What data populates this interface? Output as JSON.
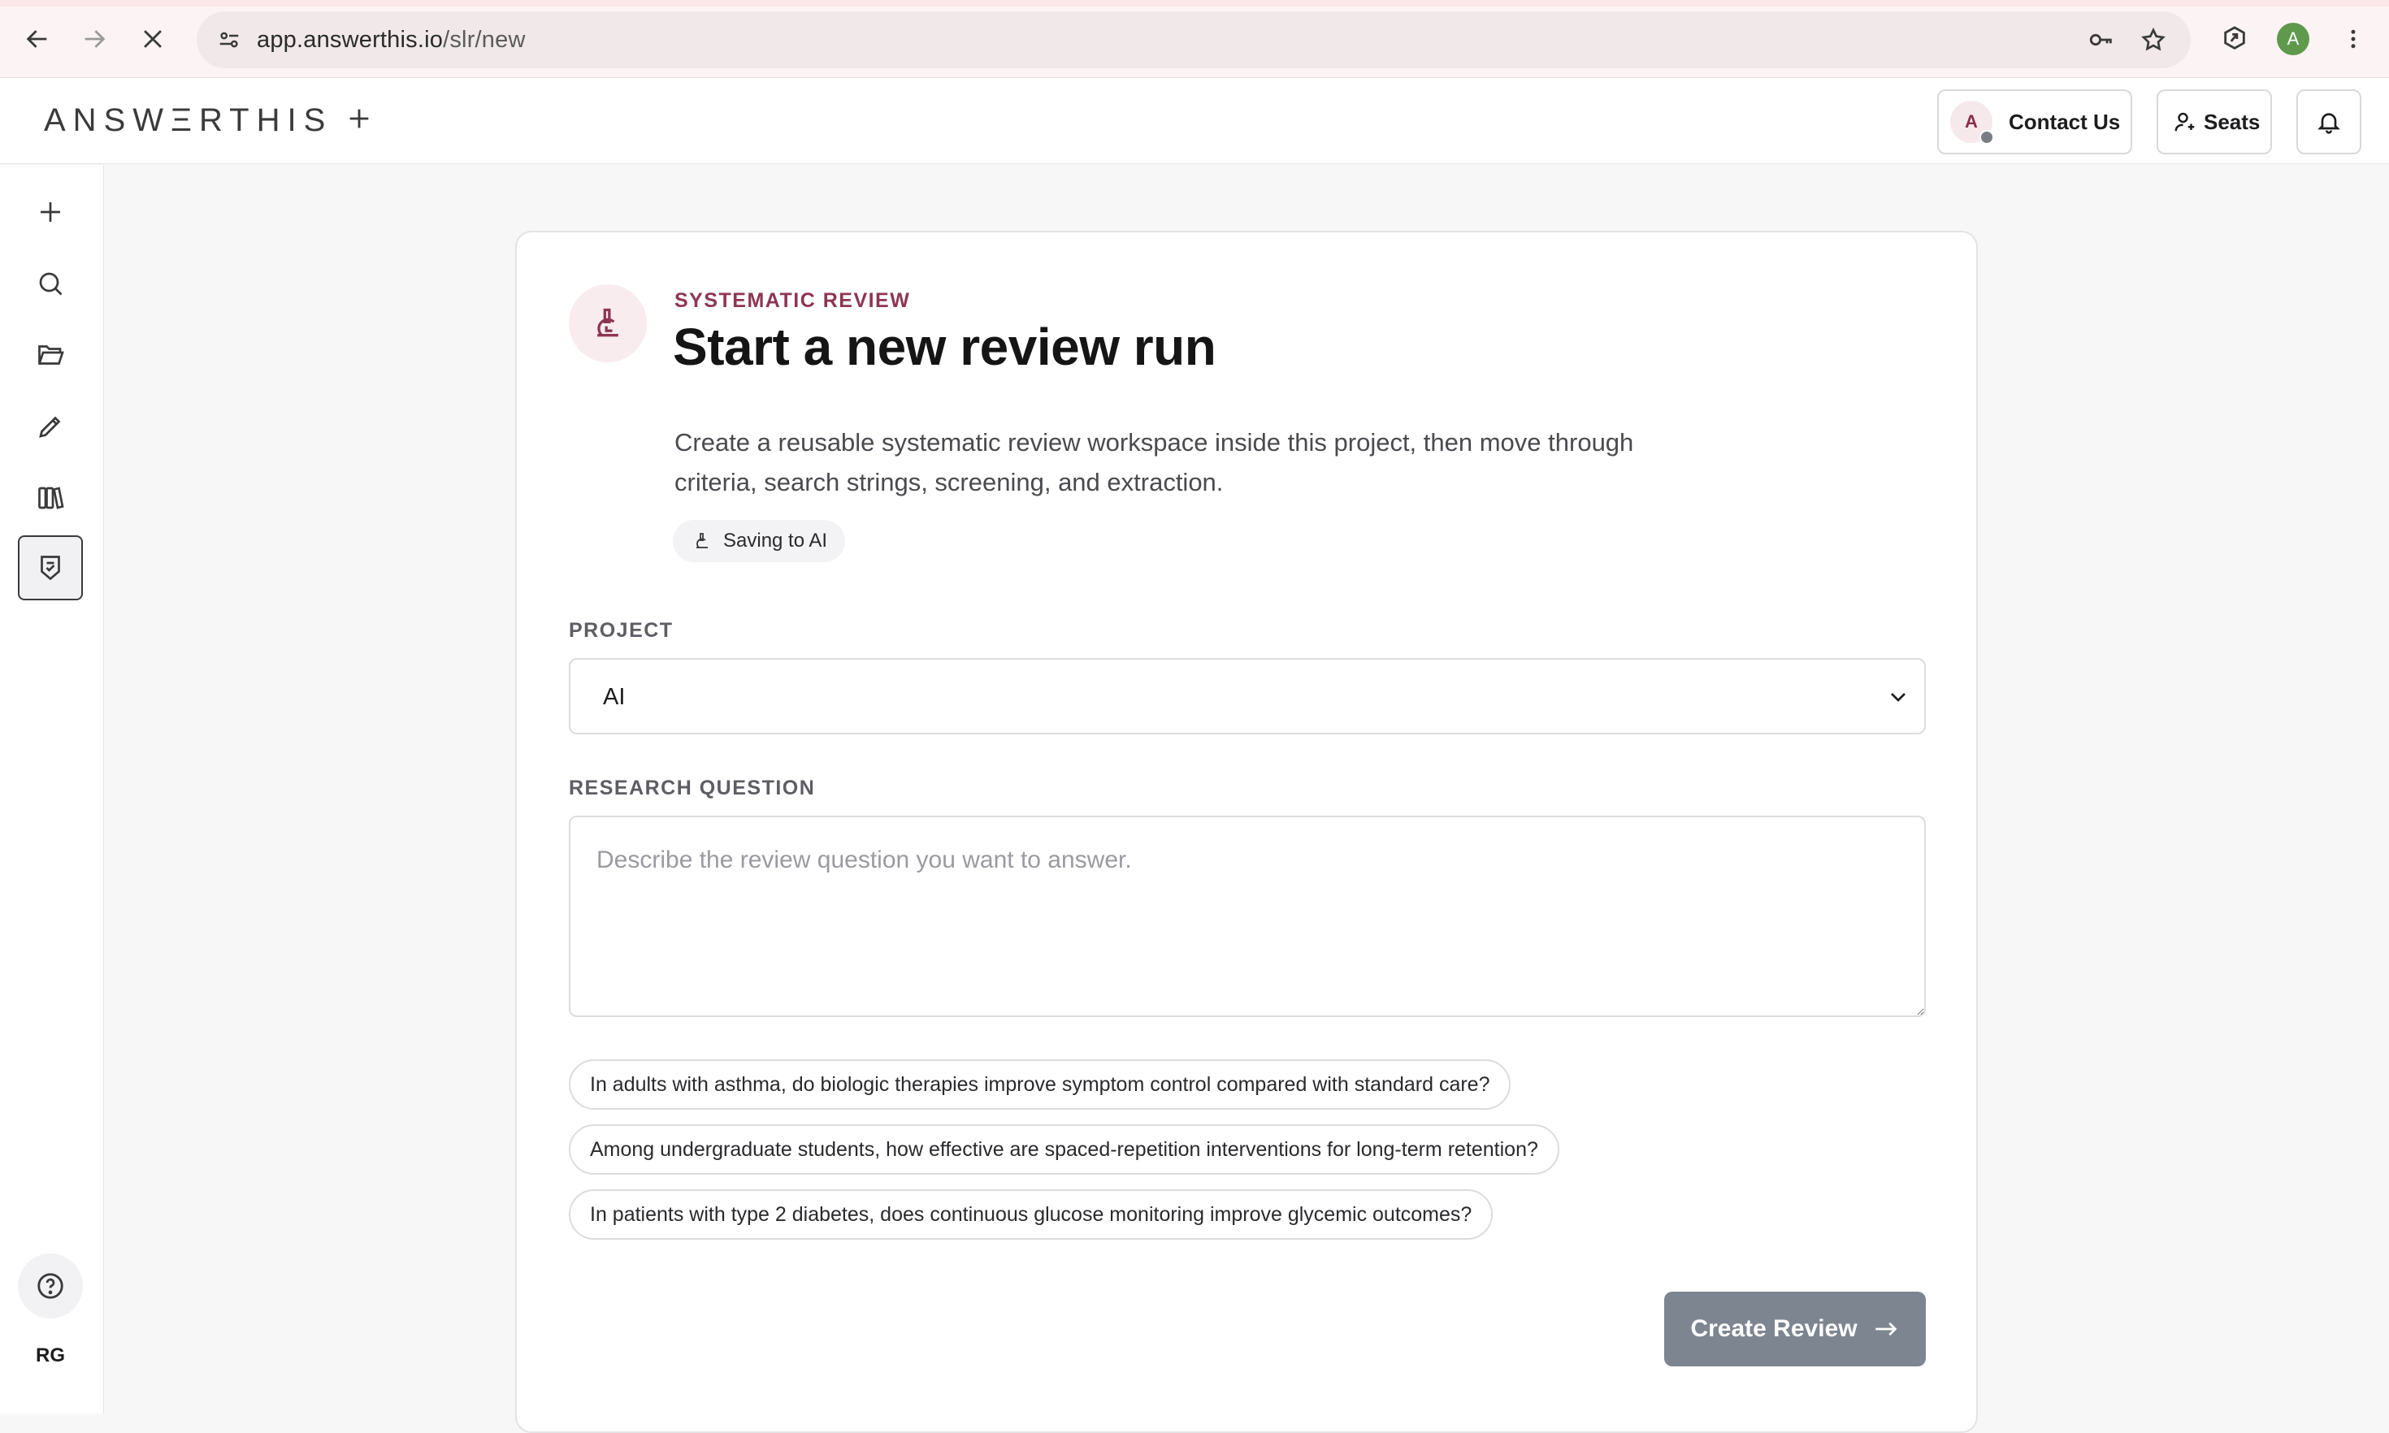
{
  "browser": {
    "url_host": "app.answerthis.io",
    "url_path": "/slr/new",
    "profile_initial": "A"
  },
  "header": {
    "logo": "ANSWΞRTHIS",
    "contact_avatar": "A",
    "contact_label": "Contact Us",
    "seats_label": "Seats"
  },
  "sidebar": {
    "items": [
      "new-icon",
      "search-icon",
      "folder-icon",
      "pen-icon",
      "library-icon",
      "review-icon"
    ],
    "user_initials": "RG"
  },
  "card": {
    "eyebrow": "SYSTEMATIC REVIEW",
    "title": "Start a new review run",
    "description": "Create a reusable systematic review workspace inside this project, then move through criteria, search strings, screening, and extraction.",
    "saving_chip": "Saving to AI",
    "project_label": "PROJECT",
    "project_value": "AI",
    "question_label": "RESEARCH QUESTION",
    "question_placeholder": "Describe the review question you want to answer.",
    "suggestions": [
      "In adults with asthma, do biologic therapies improve symptom control compared with standard care?",
      "Among undergraduate students, how effective are spaced-repetition interventions for long-term retention?",
      "In patients with type 2 diabetes, does continuous glucose monitoring improve glycemic outcomes?"
    ],
    "create_button": "Create Review"
  },
  "colors": {
    "accent": "#8e3554",
    "button_disabled": "#7d8591",
    "profile": "#5f9a4c"
  }
}
